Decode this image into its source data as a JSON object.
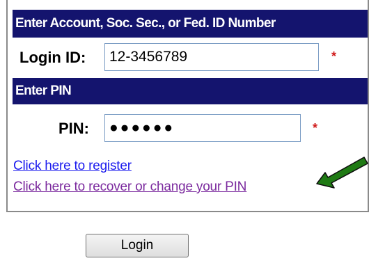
{
  "account_section": {
    "header": "Enter Account, Soc. Sec., or Fed. ID Number",
    "label": "Login ID:",
    "value": "12-3456789",
    "required_mark": "*"
  },
  "pin_section": {
    "header": "Enter PIN",
    "label": "PIN:",
    "value": "●●●●●●",
    "required_mark": "*"
  },
  "links": {
    "register": "Click here to register",
    "recover": "Click here to recover or change your PIN"
  },
  "annotation": {
    "arrow_color": "#1f7a14",
    "arrow_icon": "arrow-pointing-left-icon"
  },
  "colors": {
    "header_bg": "#14146e",
    "required": "#d01a1a",
    "link": "#1a1aee",
    "visited_link": "#7b2a9e"
  },
  "login_button": {
    "label": "Login"
  }
}
